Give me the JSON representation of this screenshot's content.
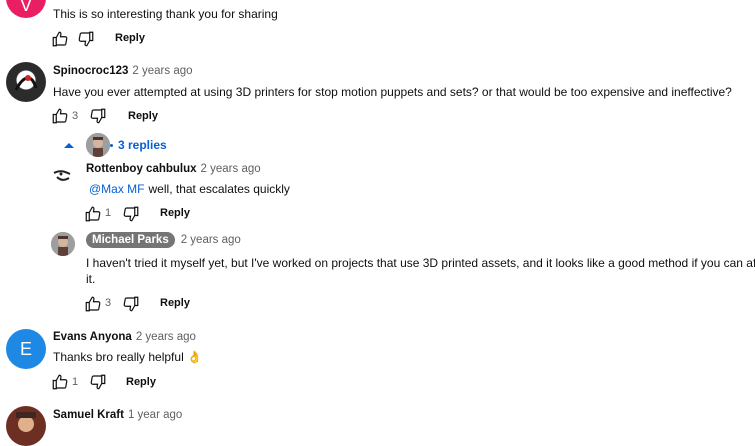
{
  "comments": [
    {
      "avatar": {
        "letter": "V",
        "color": "#e91e63"
      },
      "text": "This is so interesting thank you for sharing",
      "reply_label": "Reply"
    },
    {
      "author": "Spinocroc123",
      "time": "2 years ago",
      "text": "Have you ever attempted at using 3D printers for stop motion puppets and sets? or that would be too expensive and ineffective?",
      "likes": "3",
      "reply_label": "Reply",
      "replies_label": "3 replies",
      "replies": [
        {
          "author": "Rottenboy cahbulux",
          "time": "2 years ago",
          "mention": "@Max MF",
          "text": "well, that escalates quickly",
          "likes": "1",
          "reply_label": "Reply"
        },
        {
          "author": "Michael Parks",
          "time": "2 years ago",
          "text_line1": "I haven't tried it myself yet, but I've worked on projects that use 3D printed assets, and it looks like a good method if you can afford",
          "text_line2": "it.",
          "likes": "3",
          "reply_label": "Reply"
        }
      ]
    },
    {
      "author": "Evans Anyona",
      "time": "2 years ago",
      "avatar": {
        "letter": "E",
        "color": "#1e88e5"
      },
      "text": "Thanks bro really helpful 👌",
      "likes": "1",
      "reply_label": "Reply"
    },
    {
      "author": "Samuel Kraft",
      "time": "1 year ago"
    }
  ]
}
